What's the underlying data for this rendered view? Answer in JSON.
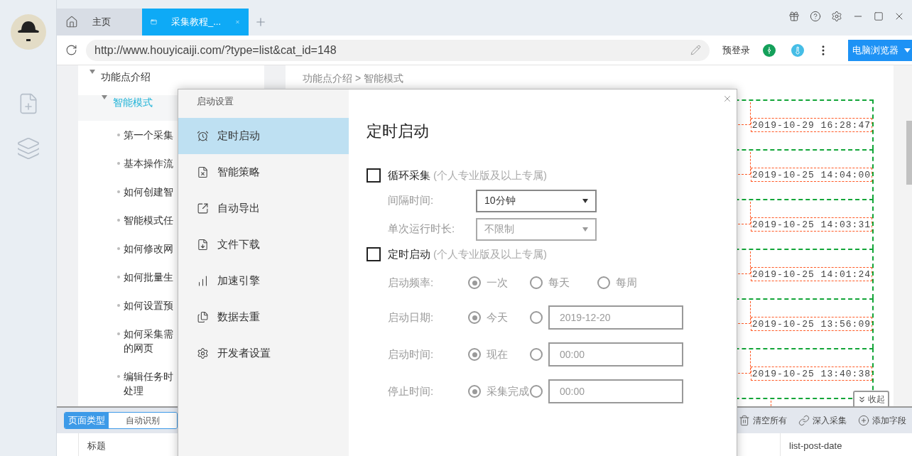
{
  "tabs": [
    {
      "label": "主页",
      "kind": "home",
      "selected": false
    },
    {
      "label": "采集教程_...",
      "kind": "page",
      "selected": true
    }
  ],
  "address_bar": {
    "url": "http://www.houyicaiji.com/?type=list&cat_id=148",
    "pre_login": "预登录",
    "browser_mode": "电脑浏览器"
  },
  "tree": [
    {
      "label": "功能点介绍",
      "expanded": true,
      "selected": false,
      "children": [
        {
          "label": "智能模式",
          "expanded": true,
          "selected": true,
          "children": [
            {
              "label": "第一个采集",
              "selected": false
            },
            {
              "label": "基本操作流",
              "selected": false
            },
            {
              "label": "如何创建智",
              "selected": false
            },
            {
              "label": "智能模式任",
              "selected": false
            },
            {
              "label": "如何修改网",
              "selected": false
            },
            {
              "label": "如何批量生",
              "selected": false
            },
            {
              "label": "如何设置预",
              "selected": false
            },
            {
              "label": "如何采集需的网页",
              "selected": false
            },
            {
              "label": "编辑任务时处理",
              "selected": false
            }
          ]
        }
      ]
    }
  ],
  "breadcrumb": "功能点介绍 > 智能模式",
  "list_rows": [
    {
      "date": "2019-10-29 16:28:47"
    },
    {
      "date": "2019-10-25 14:04:00"
    },
    {
      "date": "2019-10-25 14:03:31"
    },
    {
      "date": "2019-10-25 14:01:24"
    },
    {
      "date": "2019-10-25 13:56:09"
    },
    {
      "date": "2019-10-25 13:40:38"
    }
  ],
  "collapse_button": "收起",
  "bottom_bar": {
    "page_type_label": "页面类型",
    "page_type_value": "自动识别",
    "actions": [
      {
        "label": "清空所有",
        "kind": "trash"
      },
      {
        "label": "深入采集",
        "kind": "link"
      },
      {
        "label": "添加字段",
        "kind": "add"
      }
    ],
    "columns": [
      "标题",
      "list-post-date"
    ]
  },
  "dialog": {
    "title": "启动设置",
    "nav": [
      {
        "label": "定时启动",
        "kind": "alarm",
        "selected": true
      },
      {
        "label": "智能策略",
        "kind": "strategy",
        "selected": false
      },
      {
        "label": "自动导出",
        "kind": "export",
        "selected": false
      },
      {
        "label": "文件下载",
        "kind": "download",
        "selected": false
      },
      {
        "label": "加速引擎",
        "kind": "chart",
        "selected": false
      },
      {
        "label": "数据去重",
        "kind": "dedupe",
        "selected": false
      },
      {
        "label": "开发者设置",
        "kind": "gear",
        "selected": false
      }
    ],
    "heading": "定时启动",
    "loop": {
      "label": "循环采集",
      "note": "(个人专业版及以上专属)",
      "checked": false,
      "fields": [
        {
          "label": "间隔时间:",
          "value": "10分钟",
          "disabled": false
        },
        {
          "label": "单次运行时长:",
          "value": "不限制",
          "disabled": true
        }
      ]
    },
    "schedule": {
      "label": "定时启动",
      "note": "(个人专业版及以上专属)",
      "checked": false,
      "disabled": true,
      "rows": [
        {
          "label": "启动频率:",
          "options": [
            {
              "kind": "radio",
              "label": "一次",
              "selected": true
            },
            {
              "kind": "radio",
              "label": "每天",
              "selected": false
            },
            {
              "kind": "radio",
              "label": "每周",
              "selected": false
            }
          ]
        },
        {
          "label": "启动日期:",
          "options": [
            {
              "kind": "radio",
              "label": "今天",
              "selected": true
            },
            {
              "kind": "input",
              "value": "2019-12-20",
              "selected": false
            }
          ]
        },
        {
          "label": "启动时间:",
          "options": [
            {
              "kind": "radio",
              "label": "现在",
              "selected": true
            },
            {
              "kind": "input",
              "value": "00:00",
              "selected": false
            }
          ]
        },
        {
          "label": "停止时间:",
          "options": [
            {
              "kind": "radio",
              "label": "采集完成",
              "selected": true
            },
            {
              "kind": "input",
              "value": "00:00",
              "selected": false
            }
          ]
        }
      ]
    }
  }
}
